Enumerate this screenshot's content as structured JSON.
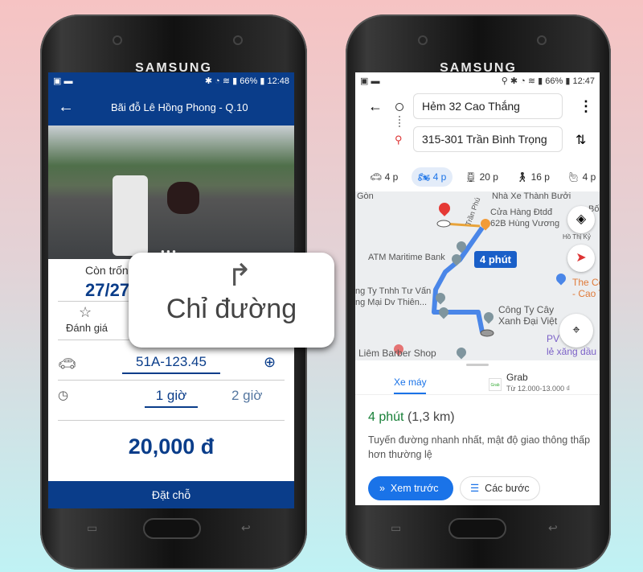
{
  "left_phone": {
    "brand": "SAMSUNG",
    "status": {
      "battery": "66%",
      "time": "12:48"
    },
    "header": {
      "title": "Bãi đỗ Lê Hồng Phong - Q.10"
    },
    "availability": {
      "label": "Còn trống",
      "value": "27/27"
    },
    "rating_label": "Đánh giá",
    "plate": "51A-123.45",
    "durations": [
      "1 giờ",
      "2 giờ"
    ],
    "price": "20,000 đ",
    "book_button": "Đặt chỗ",
    "brand_color": "#0a3d8a"
  },
  "popup": {
    "label": "Chỉ đường",
    "icon": "turn-right-arrow-icon"
  },
  "right_phone": {
    "brand": "SAMSUNG",
    "status": {
      "battery": "66%",
      "time": "12:47"
    },
    "origin": "Hẻm 32 Cao Thắng",
    "destination": "315-301 Trần Bình Trọng",
    "modes": [
      {
        "icon": "car-icon",
        "label": "4 p"
      },
      {
        "icon": "motorbike-icon",
        "label": "4 p",
        "selected": true
      },
      {
        "icon": "transit-icon",
        "label": "20 p"
      },
      {
        "icon": "walk-icon",
        "label": "16 p"
      },
      {
        "icon": "ride-icon",
        "label": "4 p"
      }
    ],
    "map_labels": [
      "Gòn",
      "Nhà Xe Thành Bưởi",
      "Cửa Hàng Đtdđ",
      "62B Hùng Vương",
      "Trần Phú",
      "Hồ Thị Kỷ",
      "ATM Maritime Bank",
      "ng Ty Tnhh Tư Vấn",
      "ng Mại Dv Thiên...",
      "Công Ty Cây",
      "Xanh Đại Việt",
      "The Co",
      "- Cao T",
      "PV",
      "lẻ xăng dầu",
      "Liêm Barber Shop",
      "Bố"
    ],
    "route_bubble": "4 phút",
    "tabs": [
      {
        "label": "Xe máy"
      },
      {
        "label": "Grab",
        "sub": "Từ 12.000-13.000 ₫",
        "logo": "Grab"
      }
    ],
    "summary": {
      "time": "4 phút",
      "distance": "(1,3 km)",
      "description": "Tuyến đường nhanh nhất, mật độ giao thông thấp hơn thường lệ"
    },
    "buttons": {
      "preview": "Xem trước",
      "steps": "Các bước"
    },
    "accent_color": "#1a73e8",
    "time_color": "#188038"
  }
}
